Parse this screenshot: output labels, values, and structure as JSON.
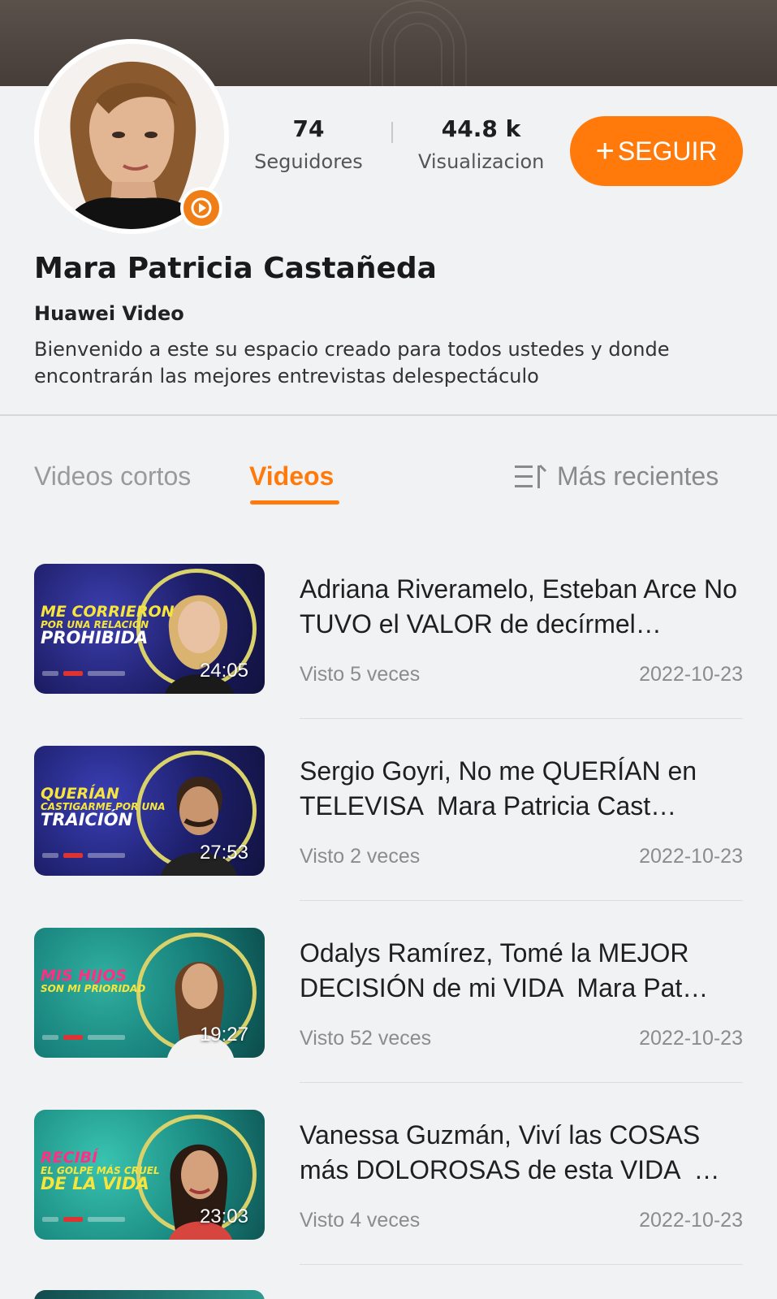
{
  "profile": {
    "followers_count": "74",
    "followers_label": "Seguidores",
    "views_count": "44.8 k",
    "views_label": "Visualizaciones",
    "follow_button": "SEGUIR",
    "follow_plus": "+",
    "name": "Mara Patricia Castañeda",
    "subtitle": "Huawei Video",
    "description": "Bienvenido a este su espacio creado para todos ustedes y donde encontrarán las mejores entrevistas delespectáculo",
    "badge_icon": "play-icon"
  },
  "tabs": [
    {
      "label": "Videos cortos",
      "active": false
    },
    {
      "label": "Videos",
      "active": true
    }
  ],
  "sort": {
    "label": "Más recientes",
    "icon": "sort-icon"
  },
  "colors": {
    "accent": "#ff7a0a",
    "background": "#f1f2f4",
    "header": "#4f4641"
  },
  "videos": [
    {
      "title": "Adriana Riveramelo, Esteban Arce No TUVO el VALOR de decírmel…",
      "views": "Visto 5 veces",
      "date": "2022-10-23",
      "duration": "24:05",
      "thumb_caption": [
        "ME CORRIERON",
        "POR UNA RELACIÓN",
        "PROHIBIDA"
      ]
    },
    {
      "title": "Sergio Goyri, No me QUERÍAN en TELEVISA  Mara Patricia Cast…",
      "views": "Visto 2 veces",
      "date": "2022-10-23",
      "duration": "27:53",
      "thumb_caption": [
        "QUERÍAN",
        "CASTIGARME POR UNA",
        "TRAICIÓN"
      ]
    },
    {
      "title": "Odalys Ramírez, Tomé la MEJOR DECISIÓN de mi VIDA  Mara Pat…",
      "views": "Visto 52 veces",
      "date": "2022-10-23",
      "duration": "19:27",
      "thumb_caption": [
        "MIS HIJOS",
        "SON MI PRIORIDAD",
        ""
      ]
    },
    {
      "title": "Vanessa Guzmán, Viví las COSAS más DOLOROSAS de esta VIDA  …",
      "views": "Visto 4 veces",
      "date": "2022-10-23",
      "duration": "23:03",
      "thumb_caption": [
        "RECIBÍ",
        "EL GOLPE MÁS CRUEL",
        "DE LA VIDA"
      ]
    }
  ]
}
